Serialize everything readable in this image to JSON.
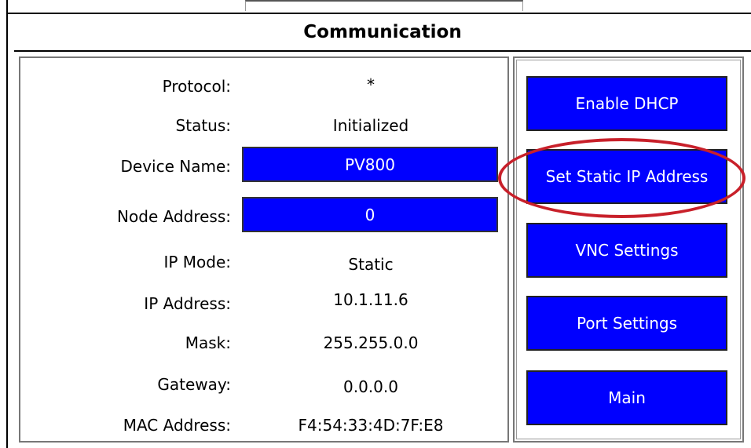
{
  "title": "Communication",
  "fields": {
    "protocol": {
      "label": "Protocol:",
      "value": "*"
    },
    "status": {
      "label": "Status:",
      "value": "Initialized"
    },
    "device_name": {
      "label": "Device Name:",
      "value": "PV800"
    },
    "node_address": {
      "label": "Node Address:",
      "value": "0"
    },
    "ip_mode": {
      "label": "IP Mode:",
      "value": "Static"
    },
    "ip_address": {
      "label": "IP Address:",
      "value": "10.1.11.6"
    },
    "mask": {
      "label": "Mask:",
      "value": "255.255.0.0"
    },
    "gateway": {
      "label": "Gateway:",
      "value": "0.0.0.0"
    },
    "mac_address": {
      "label": "MAC Address:",
      "value": "F4:54:33:4D:7F:E8"
    }
  },
  "buttons": {
    "enable_dhcp": "Enable DHCP",
    "set_static_ip": "Set Static IP Address",
    "vnc_settings": "VNC Settings",
    "port_settings": "Port Settings",
    "main": "Main"
  },
  "colors": {
    "button_blue": "#0000ff",
    "highlight_red": "#c8202a"
  }
}
